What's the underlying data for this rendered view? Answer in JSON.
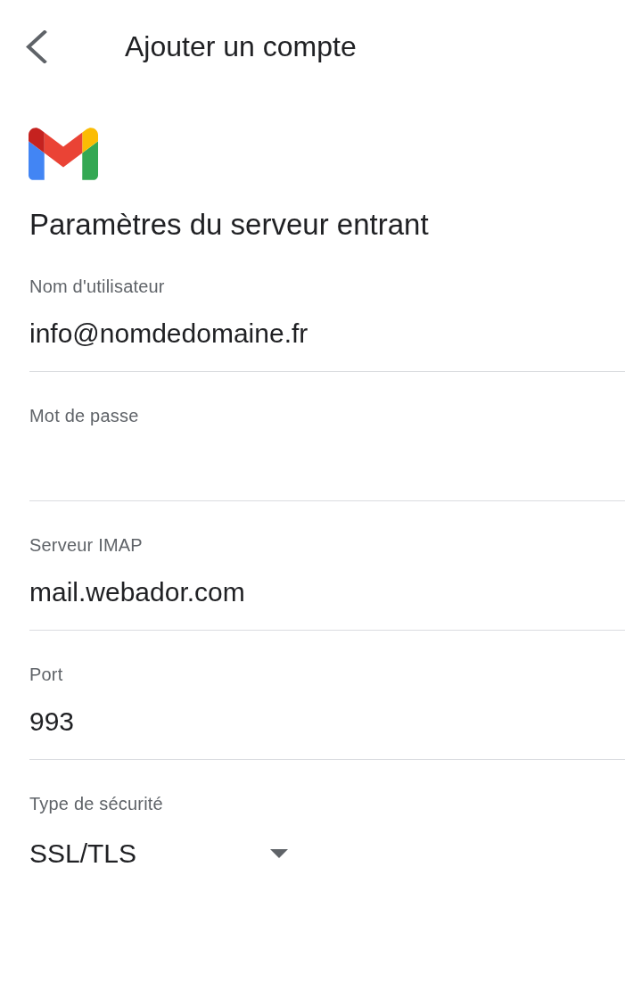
{
  "header": {
    "title": "Ajouter un compte"
  },
  "heading": "Paramètres du serveur entrant",
  "fields": [
    {
      "kind": "text",
      "label": "Nom d'utilisateur",
      "value": "info@nomdedomaine.fr"
    },
    {
      "kind": "password",
      "label": "Mot de passe"
    },
    {
      "kind": "text",
      "label": "Serveur IMAP",
      "value": "mail.webador.com"
    },
    {
      "kind": "text",
      "label": "Port",
      "value": "993"
    },
    {
      "kind": "select",
      "label": "Type de sécurité",
      "value": "SSL/TLS"
    }
  ]
}
